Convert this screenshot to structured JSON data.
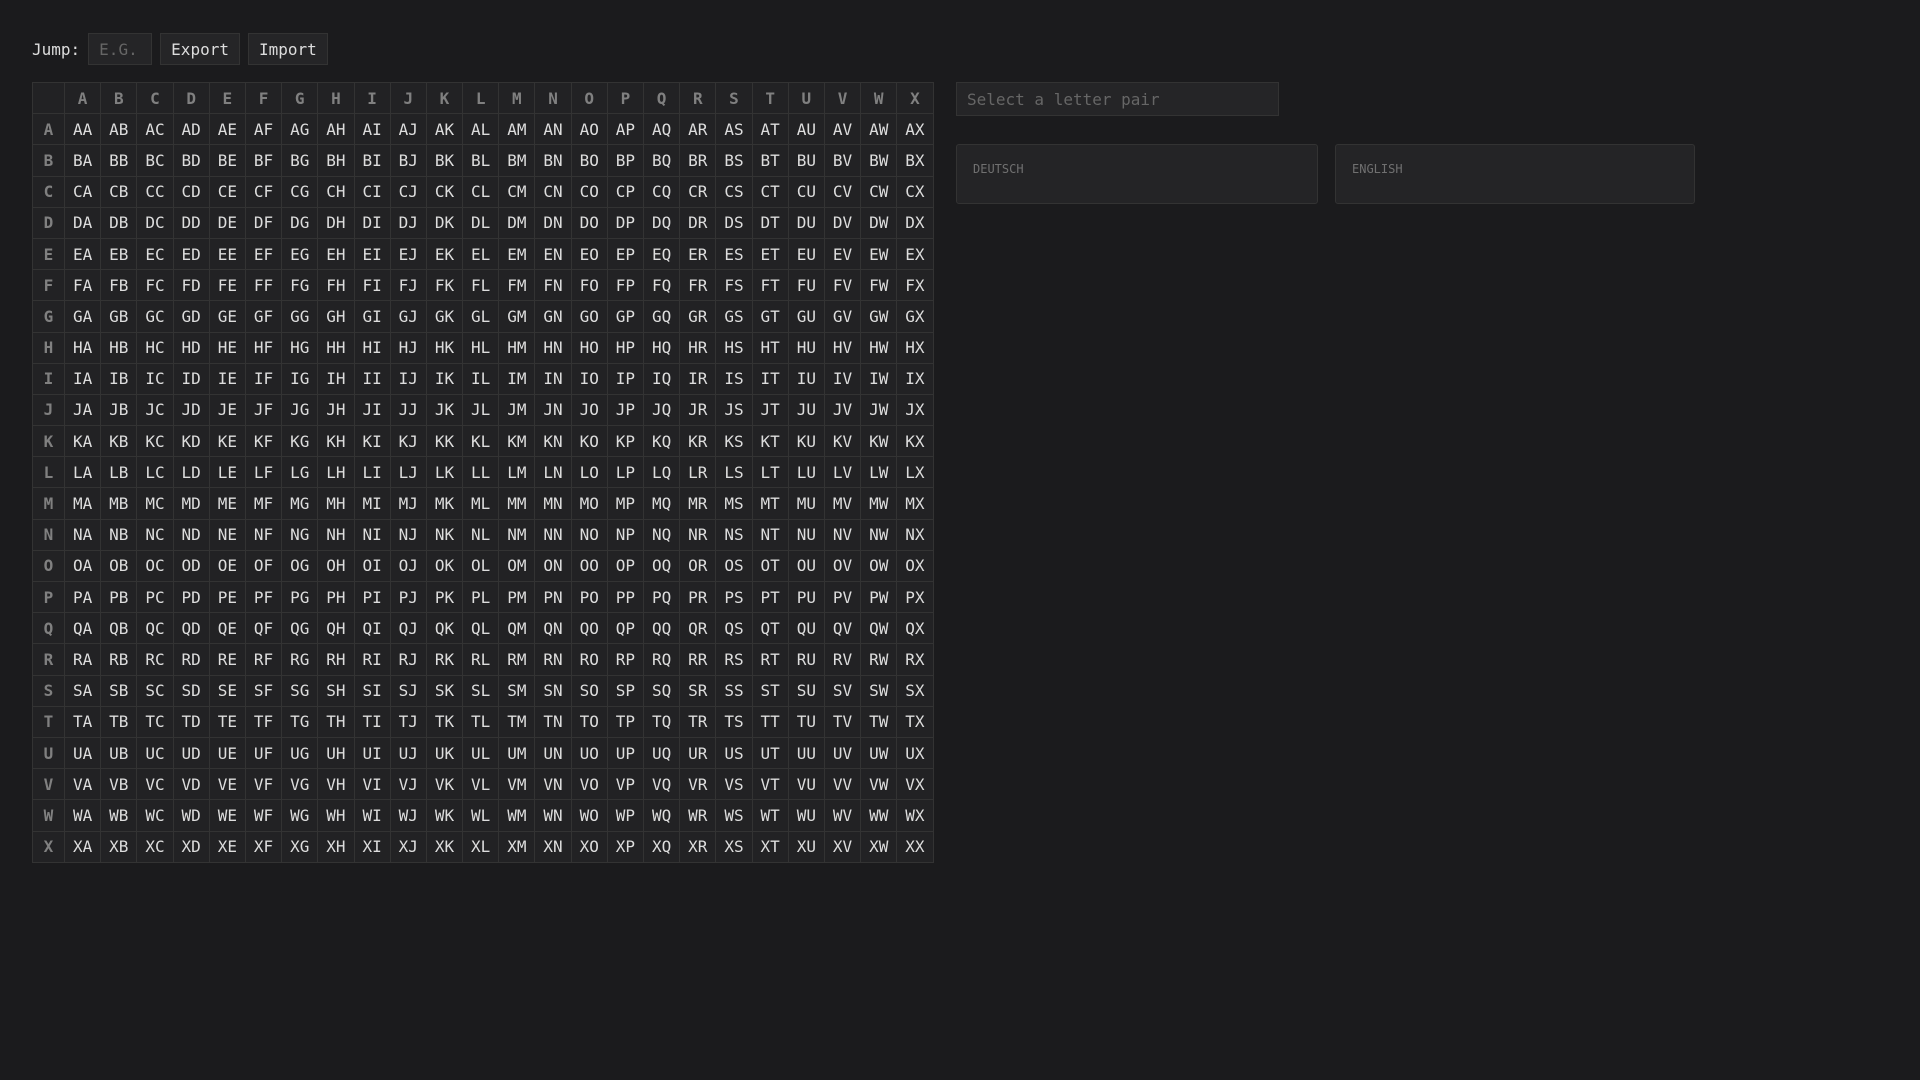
{
  "toolbar": {
    "jump_label": "Jump:",
    "jump_placeholder": "E.G.",
    "export_label": "Export",
    "import_label": "Import"
  },
  "grid": {
    "letters": [
      "A",
      "B",
      "C",
      "D",
      "E",
      "F",
      "G",
      "H",
      "I",
      "J",
      "K",
      "L",
      "M",
      "N",
      "O",
      "P",
      "Q",
      "R",
      "S",
      "T",
      "U",
      "V",
      "W",
      "X"
    ]
  },
  "detail": {
    "pair_placeholder": "Select a letter pair",
    "deutsch_label": "DEUTSCH",
    "english_label": "ENGLISH"
  }
}
